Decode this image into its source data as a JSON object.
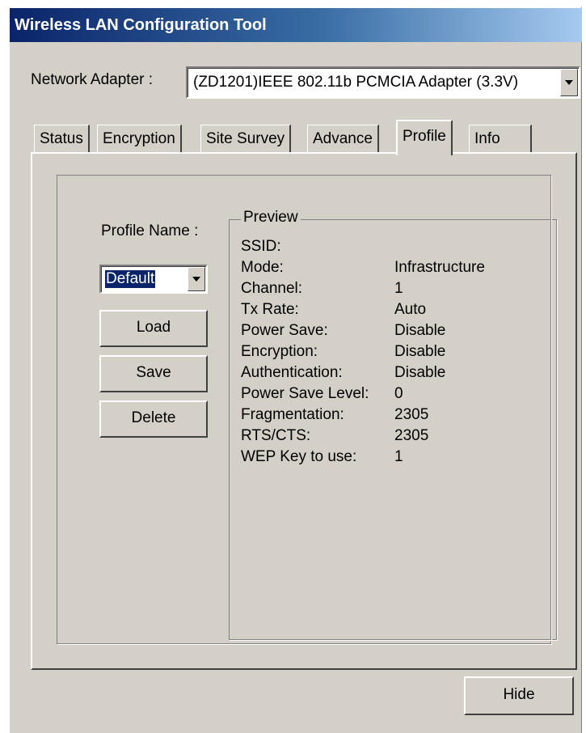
{
  "window": {
    "title": "Wireless LAN Configuration Tool"
  },
  "adapter": {
    "label": "Network Adapter :",
    "selected": "(ZD1201)IEEE 802.11b PCMCIA Adapter (3.3V)"
  },
  "tabs": [
    {
      "label": "Status"
    },
    {
      "label": "Encryption"
    },
    {
      "label": "Site Survey"
    },
    {
      "label": "Advance"
    },
    {
      "label": "Profile",
      "active": true
    },
    {
      "label": "Info"
    }
  ],
  "profile": {
    "name_label": "Profile Name :",
    "selected": "Default",
    "load_label": "Load",
    "save_label": "Save",
    "delete_label": "Delete"
  },
  "preview": {
    "title": "Preview",
    "rows": [
      {
        "key": "SSID:",
        "value": ""
      },
      {
        "key": "Mode:",
        "value": "Infrastructure"
      },
      {
        "key": "Channel:",
        "value": "1"
      },
      {
        "key": "Tx Rate:",
        "value": "Auto"
      },
      {
        "key": "Power Save:",
        "value": "Disable"
      },
      {
        "key": "Encryption:",
        "value": "Disable"
      },
      {
        "key": "Authentication:",
        "value": "Disable"
      },
      {
        "key": "Power Save Level:",
        "value": "0"
      },
      {
        "key": "Fragmentation:",
        "value": "2305"
      },
      {
        "key": "RTS/CTS:",
        "value": "2305"
      },
      {
        "key": "WEP Key to use:",
        "value": "1"
      }
    ]
  },
  "footer": {
    "hide_label": "Hide"
  },
  "colors": {
    "titlebar": "#0a246a",
    "face": "#d4d0c8",
    "selection": "#0a246a"
  }
}
